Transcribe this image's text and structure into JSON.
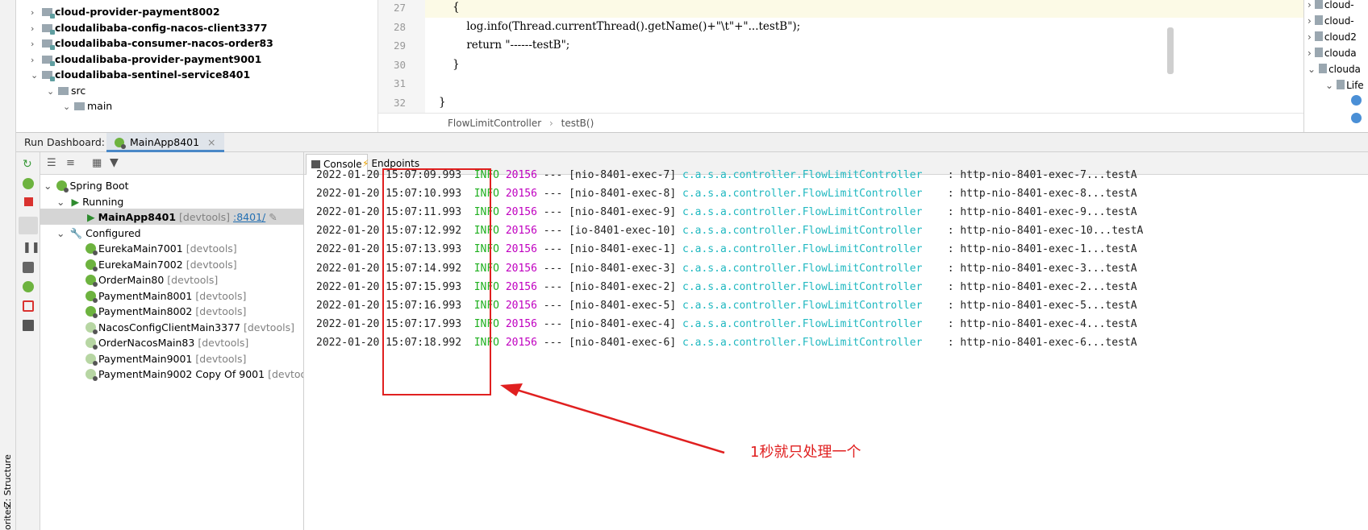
{
  "project_tree": [
    {
      "label": "cloud-provider-payment8002",
      "level": 1,
      "expanded": false,
      "type": "module"
    },
    {
      "label": "cloudalibaba-config-nacos-client3377",
      "level": 1,
      "expanded": false,
      "type": "module"
    },
    {
      "label": "cloudalibaba-consumer-nacos-order83",
      "level": 1,
      "expanded": false,
      "type": "module"
    },
    {
      "label": "cloudalibaba-provider-payment9001",
      "level": 1,
      "expanded": false,
      "type": "module"
    },
    {
      "label": "cloudalibaba-sentinel-service8401",
      "level": 1,
      "expanded": true,
      "type": "module"
    },
    {
      "label": "src",
      "level": 2,
      "expanded": true,
      "type": "folder"
    },
    {
      "label": "main",
      "level": 3,
      "expanded": true,
      "type": "folder"
    }
  ],
  "editor": {
    "lines": [
      {
        "num": "27",
        "text": "    {"
      },
      {
        "num": "28",
        "text": "        log.info(Thread.currentThread().getName()+\"\\t\"+\"...testB\");"
      },
      {
        "num": "29",
        "text": "        return \"------testB\";"
      },
      {
        "num": "30",
        "text": "    }"
      },
      {
        "num": "31",
        "text": ""
      },
      {
        "num": "32",
        "text": "}"
      }
    ],
    "breadcrumb_class": "FlowLimitController",
    "breadcrumb_sep": "›",
    "breadcrumb_method": "testB()"
  },
  "right_pane": [
    {
      "label": "cloud-",
      "arrow": "›"
    },
    {
      "label": "cloud-",
      "arrow": "›"
    },
    {
      "label": "cloud2",
      "arrow": "›"
    },
    {
      "label": "clouda",
      "arrow": "›"
    },
    {
      "label": "clouda",
      "arrow": "⌄"
    },
    {
      "label": "Life",
      "arrow": "⌄"
    }
  ],
  "dashboard": {
    "title": "Run Dashboard:",
    "tab_label": "MainApp8401",
    "tab_close": "×"
  },
  "run_tree": {
    "root": "Spring Boot",
    "running_group": "Running",
    "running_app": "MainApp8401",
    "running_tag": "[devtools]",
    "running_port": ":8401/",
    "configured_group": "Configured",
    "configured": [
      {
        "name": "EurekaMain7001",
        "tag": "[devtools]",
        "dim": false
      },
      {
        "name": "EurekaMain7002",
        "tag": "[devtools]",
        "dim": false
      },
      {
        "name": "OrderMain80",
        "tag": "[devtools]",
        "dim": false
      },
      {
        "name": "PaymentMain8001",
        "tag": "[devtools]",
        "dim": false
      },
      {
        "name": "PaymentMain8002",
        "tag": "[devtools]",
        "dim": false
      },
      {
        "name": "NacosConfigClientMain3377",
        "tag": "[devtools]",
        "dim": true
      },
      {
        "name": "OrderNacosMain83",
        "tag": "[devtools]",
        "dim": true
      },
      {
        "name": "PaymentMain9001",
        "tag": "[devtools]",
        "dim": true
      },
      {
        "name": "PaymentMain9002 Copy Of 9001",
        "tag": "[devtools",
        "dim": true
      }
    ]
  },
  "console": {
    "tab_console": "Console",
    "tab_endpoints": "Endpoints",
    "logs": [
      {
        "date": "2022-01-20",
        "time": "15:07:09.993",
        "level": "INFO",
        "pid": "20156",
        "sep": "---",
        "thread": "[nio-8401-exec-7]",
        "cls": "c.a.s.a.controller.FlowLimitController",
        "msg": ": http-nio-8401-exec-7...testA"
      },
      {
        "date": "2022-01-20",
        "time": "15:07:10.993",
        "level": "INFO",
        "pid": "20156",
        "sep": "---",
        "thread": "[nio-8401-exec-8]",
        "cls": "c.a.s.a.controller.FlowLimitController",
        "msg": ": http-nio-8401-exec-8...testA"
      },
      {
        "date": "2022-01-20",
        "time": "15:07:11.993",
        "level": "INFO",
        "pid": "20156",
        "sep": "---",
        "thread": "[nio-8401-exec-9]",
        "cls": "c.a.s.a.controller.FlowLimitController",
        "msg": ": http-nio-8401-exec-9...testA"
      },
      {
        "date": "2022-01-20",
        "time": "15:07:12.992",
        "level": "INFO",
        "pid": "20156",
        "sep": "---",
        "thread": "[io-8401-exec-10]",
        "cls": "c.a.s.a.controller.FlowLimitController",
        "msg": ": http-nio-8401-exec-10...testA"
      },
      {
        "date": "2022-01-20",
        "time": "15:07:13.993",
        "level": "INFO",
        "pid": "20156",
        "sep": "---",
        "thread": "[nio-8401-exec-1]",
        "cls": "c.a.s.a.controller.FlowLimitController",
        "msg": ": http-nio-8401-exec-1...testA"
      },
      {
        "date": "2022-01-20",
        "time": "15:07:14.992",
        "level": "INFO",
        "pid": "20156",
        "sep": "---",
        "thread": "[nio-8401-exec-3]",
        "cls": "c.a.s.a.controller.FlowLimitController",
        "msg": ": http-nio-8401-exec-3...testA"
      },
      {
        "date": "2022-01-20",
        "time": "15:07:15.993",
        "level": "INFO",
        "pid": "20156",
        "sep": "---",
        "thread": "[nio-8401-exec-2]",
        "cls": "c.a.s.a.controller.FlowLimitController",
        "msg": ": http-nio-8401-exec-2...testA"
      },
      {
        "date": "2022-01-20",
        "time": "15:07:16.993",
        "level": "INFO",
        "pid": "20156",
        "sep": "---",
        "thread": "[nio-8401-exec-5]",
        "cls": "c.a.s.a.controller.FlowLimitController",
        "msg": ": http-nio-8401-exec-5...testA"
      },
      {
        "date": "2022-01-20",
        "time": "15:07:17.993",
        "level": "INFO",
        "pid": "20156",
        "sep": "---",
        "thread": "[nio-8401-exec-4]",
        "cls": "c.a.s.a.controller.FlowLimitController",
        "msg": ": http-nio-8401-exec-4...testA"
      },
      {
        "date": "2022-01-20",
        "time": "15:07:18.992",
        "level": "INFO",
        "pid": "20156",
        "sep": "---",
        "thread": "[nio-8401-exec-6]",
        "cls": "c.a.s.a.controller.FlowLimitController",
        "msg": ": http-nio-8401-exec-6...testA"
      }
    ]
  },
  "annotation": "1秒就只处理一个",
  "side_labels": {
    "structure": "Z: Structure",
    "favorites": "orites"
  },
  "colors": {
    "annotation": "#e02020",
    "info": "#20b020",
    "pid": "#c000c0",
    "class": "#20b8c0"
  }
}
